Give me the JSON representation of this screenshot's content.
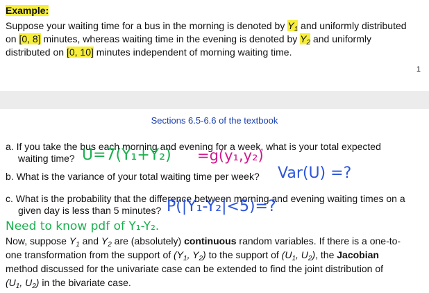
{
  "top": {
    "label": "Example:",
    "p1": {
      "a": "Suppose your waiting time for a bus in the morning is denoted by ",
      "y1": "Y",
      "y1_sub": "1",
      "b": " and uniformly distributed",
      "c": "on ",
      "r1": "[0, 8]",
      "d": " minutes, whereas waiting time in the evening is denoted by ",
      "y2": "Y",
      "y2_sub": "2",
      "e": " and uniformly",
      "f": "distributed on ",
      "r2": "[0, 10]",
      "g": " minutes independent of morning waiting time."
    },
    "page_number": "1"
  },
  "bottom": {
    "section_ref": "Sections 6.5-6.6 of the textbook",
    "qa": {
      "l1": "a. If you take the bus each morning and evening for a week, what is your total expected",
      "l2": "waiting time?"
    },
    "qb": "b. What is the variance of your total waiting time per week?",
    "qc": {
      "l1": "c. What is the probability that the difference between morning and evening waiting times on a",
      "l2": "given day is less than 5 minutes?"
    },
    "para": {
      "l1a": "Now, suppose ",
      "y1": "Y",
      "y1_sub": "1",
      "l1b": " and ",
      "y2": "Y",
      "y2_sub": "2",
      "l1c": " are (absolutely) ",
      "l1d": "continuous",
      "l1e": " random variables. If there is a one-to-",
      "l2a": "one transformation from the support of ",
      "l2b": "(Y",
      "l2b_s1": "1",
      "l2b_m": ", Y",
      "l2b_s2": "2",
      "l2b_e": ")",
      "l2c": " to the support of ",
      "l2d": "(U",
      "l2d_s1": "1",
      "l2d_m": ", U",
      "l2d_s2": "2",
      "l2d_e": ")",
      "l2e": ", the ",
      "l2f": "Jacobian",
      "l3": "method discussed for the univariate case can be extended to find the joint distribution of",
      "l4a": "(U",
      "l4a_s1": "1",
      "l4a_m": ", U",
      "l4a_s2": "2",
      "l4a_e": ")",
      "l4b": " in the bivariate case."
    },
    "handwriting": {
      "u_eq": "U=7(Y₁+Y₂)",
      "g_eq": "=g(y₁,y₂)",
      "var": "Var(U) =?",
      "prob": "P(|Y₁-Y₂|<5)=?",
      "note": "Need to know pdf of Y₁-Y₂."
    }
  }
}
